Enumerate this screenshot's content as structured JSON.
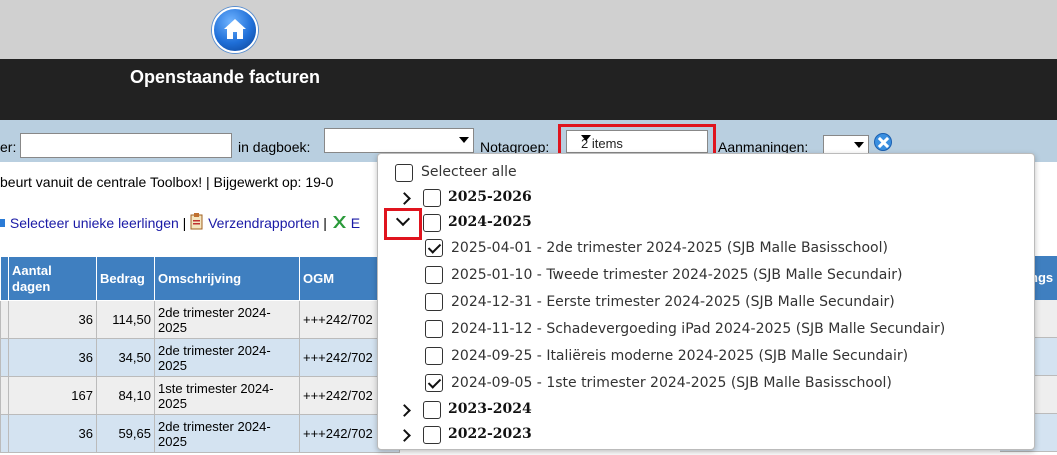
{
  "header": {
    "title": "Openstaande facturen",
    "home_icon": "home-icon"
  },
  "filters": {
    "search_label_fragment": "er:",
    "search_value": "",
    "dagboek_label": "in dagboek:",
    "dagboek_value": "",
    "notagroep_label": "Notagroep:",
    "notagroep_value": "2 items",
    "aanmaningen_label": "Aanmaningen:",
    "aanmaningen_value": ""
  },
  "info_line": "beurt vanuit de centrale Toolbox! | Bijgewerkt op: 19-0",
  "links": {
    "unique_students": "Selecteer unieke leerlingen",
    "separator": "|",
    "send_reports": "Verzendrapporten",
    "excel_fragment": "E"
  },
  "table": {
    "headers": [
      "",
      "Aantal dagen",
      "Bedrag",
      "Omschrijving",
      "OGM"
    ],
    "right_header_fragment": "ngs",
    "rows": [
      {
        "days": "36",
        "amount": "114,50",
        "description": "2de trimester 2024-2025",
        "ogm": "+++242/702"
      },
      {
        "days": "36",
        "amount": "34,50",
        "description": "2de trimester 2024-2025",
        "ogm": "+++242/702"
      },
      {
        "days": "167",
        "amount": "84,10",
        "description": "1ste trimester 2024-2025",
        "ogm": "+++242/702"
      },
      {
        "days": "36",
        "amount": "59,65",
        "description": "2de trimester 2024-2025",
        "ogm": "+++242/702"
      }
    ]
  },
  "dropdown": {
    "select_all": "Selecteer alle",
    "groups": [
      {
        "label": "2025-2026",
        "expanded": false,
        "checked": false
      },
      {
        "label": "2024-2025",
        "expanded": true,
        "checked": false
      },
      {
        "label": "2023-2024",
        "expanded": false,
        "checked": false
      },
      {
        "label": "2022-2023",
        "expanded": false,
        "checked": false
      }
    ],
    "items": [
      {
        "label": "2025-04-01 - 2de trimester 2024-2025 (SJB Malle Basisschool)",
        "checked": true
      },
      {
        "label": "2025-01-10 - Tweede trimester 2024-2025 (SJB Malle Secundair)",
        "checked": false
      },
      {
        "label": "2024-12-31 - Eerste trimester 2024-2025 (SJB Malle Secundair)",
        "checked": false
      },
      {
        "label": "2024-11-12 - Schadevergoeding iPad 2024-2025 (SJB Malle Secundair)",
        "checked": false
      },
      {
        "label": "2024-09-25 - Italiëreis moderne 2024-2025 (SJB Malle Secundair)",
        "checked": false
      },
      {
        "label": "2024-09-05 - 1ste trimester 2024-2025 (SJB Malle Basisschool)",
        "checked": true
      }
    ]
  },
  "colors": {
    "header_bg": "#222222",
    "filter_bg": "#b9cfe0",
    "table_header": "#3f7fc0",
    "highlight": "#e0141e"
  }
}
